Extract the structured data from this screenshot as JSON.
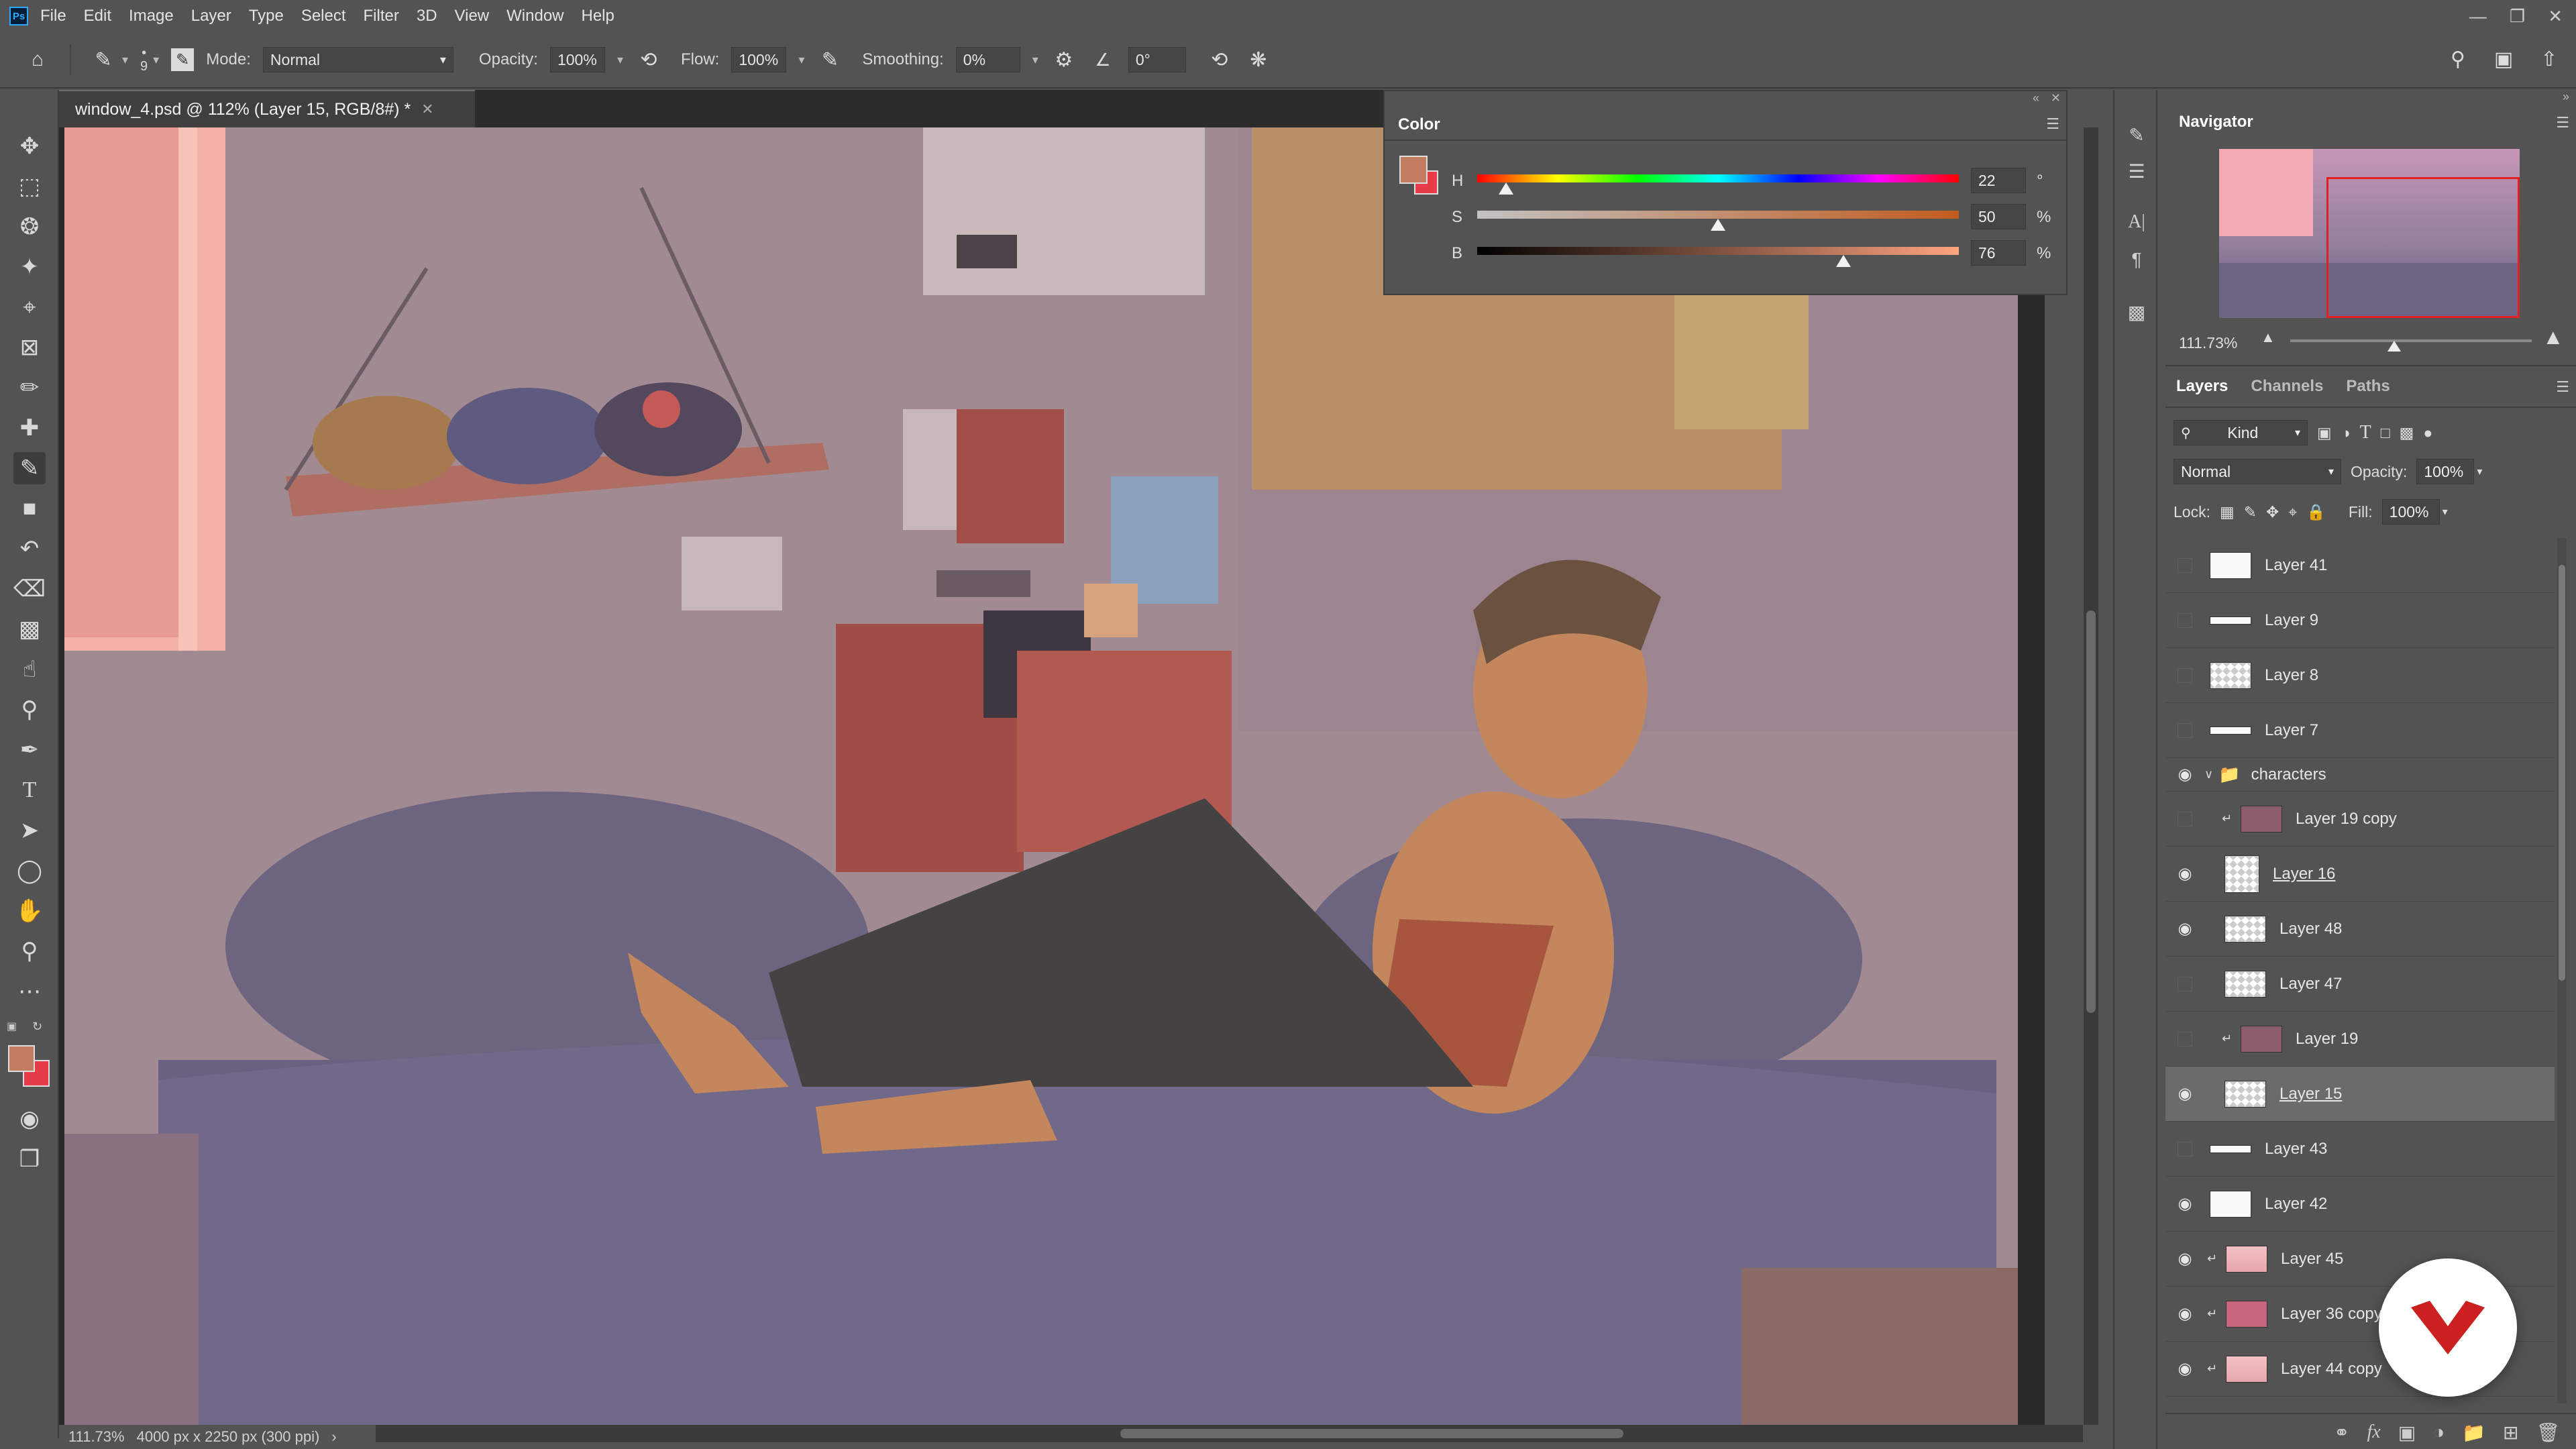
{
  "app": {
    "logo": "Ps",
    "menu": [
      "File",
      "Edit",
      "Image",
      "Layer",
      "Type",
      "Select",
      "Filter",
      "3D",
      "View",
      "Window",
      "Help"
    ]
  },
  "options": {
    "brush_size": "9",
    "mode_label": "Mode:",
    "mode_value": "Normal",
    "opacity_label": "Opacity:",
    "opacity_value": "100%",
    "flow_label": "Flow:",
    "flow_value": "100%",
    "smoothing_label": "Smoothing:",
    "smoothing_value": "0%",
    "angle_value": "0°"
  },
  "document": {
    "tab_title": "window_4.psd @ 112% (Layer 15, RGB/8#) *",
    "status_zoom": "111.73%",
    "status_size": "4000 px x 2250 px (300 ppi)",
    "status_arrow": "›"
  },
  "color_panel": {
    "title": "Color",
    "foreground": "#c27d61",
    "background": "#e63c4a",
    "h_label": "H",
    "s_label": "S",
    "b_label": "B",
    "h_value": "22",
    "s_value": "50",
    "b_value": "76",
    "h_unit": "°",
    "s_unit": "%",
    "b_unit": "%",
    "h_fraction": 0.06,
    "s_fraction": 0.5,
    "b_fraction": 0.76
  },
  "navigator": {
    "title": "Navigator",
    "zoom": "111.73%",
    "zoom_fraction": 0.43
  },
  "layers_panel": {
    "tabs": [
      "Layers",
      "Channels",
      "Paths"
    ],
    "filter_kind": "Kind",
    "blend_mode": "Normal",
    "opacity_label": "Opacity:",
    "opacity_value": "100%",
    "lock_label": "Lock:",
    "fill_label": "Fill:",
    "fill_value": "100%",
    "layers": [
      {
        "name": "Layer 41",
        "visible": false,
        "thumb": "white"
      },
      {
        "name": "Layer 9",
        "visible": false,
        "thumb": "strip"
      },
      {
        "name": "Layer 8",
        "visible": false,
        "thumb": "checker"
      },
      {
        "name": "Layer 7",
        "visible": false,
        "thumb": "strip"
      },
      {
        "name": "characters",
        "visible": true,
        "thumb": "folder"
      },
      {
        "name": "Layer 19 copy",
        "visible": false,
        "thumb": "mauve",
        "clipped": true
      },
      {
        "name": "Layer 16",
        "visible": true,
        "thumb": "checker"
      },
      {
        "name": "Layer 48",
        "visible": true,
        "thumb": "checker"
      },
      {
        "name": "Layer 47",
        "visible": false,
        "thumb": "checker"
      },
      {
        "name": "Layer 19",
        "visible": false,
        "thumb": "mauve",
        "clipped": true
      },
      {
        "name": "Layer 15",
        "visible": true,
        "thumb": "checker",
        "selected": true
      },
      {
        "name": "Layer 43",
        "visible": false,
        "thumb": "strip"
      },
      {
        "name": "Layer 42",
        "visible": true,
        "thumb": "white"
      },
      {
        "name": "Layer 45",
        "visible": true,
        "thumb": "pink",
        "clipped": true
      },
      {
        "name": "Layer 36 copy",
        "visible": true,
        "thumb": "rose",
        "clipped": true
      },
      {
        "name": "Layer 44 copy",
        "visible": true,
        "thumb": "pink",
        "clipped": true
      }
    ]
  },
  "badge_color": "#cc1f1f"
}
